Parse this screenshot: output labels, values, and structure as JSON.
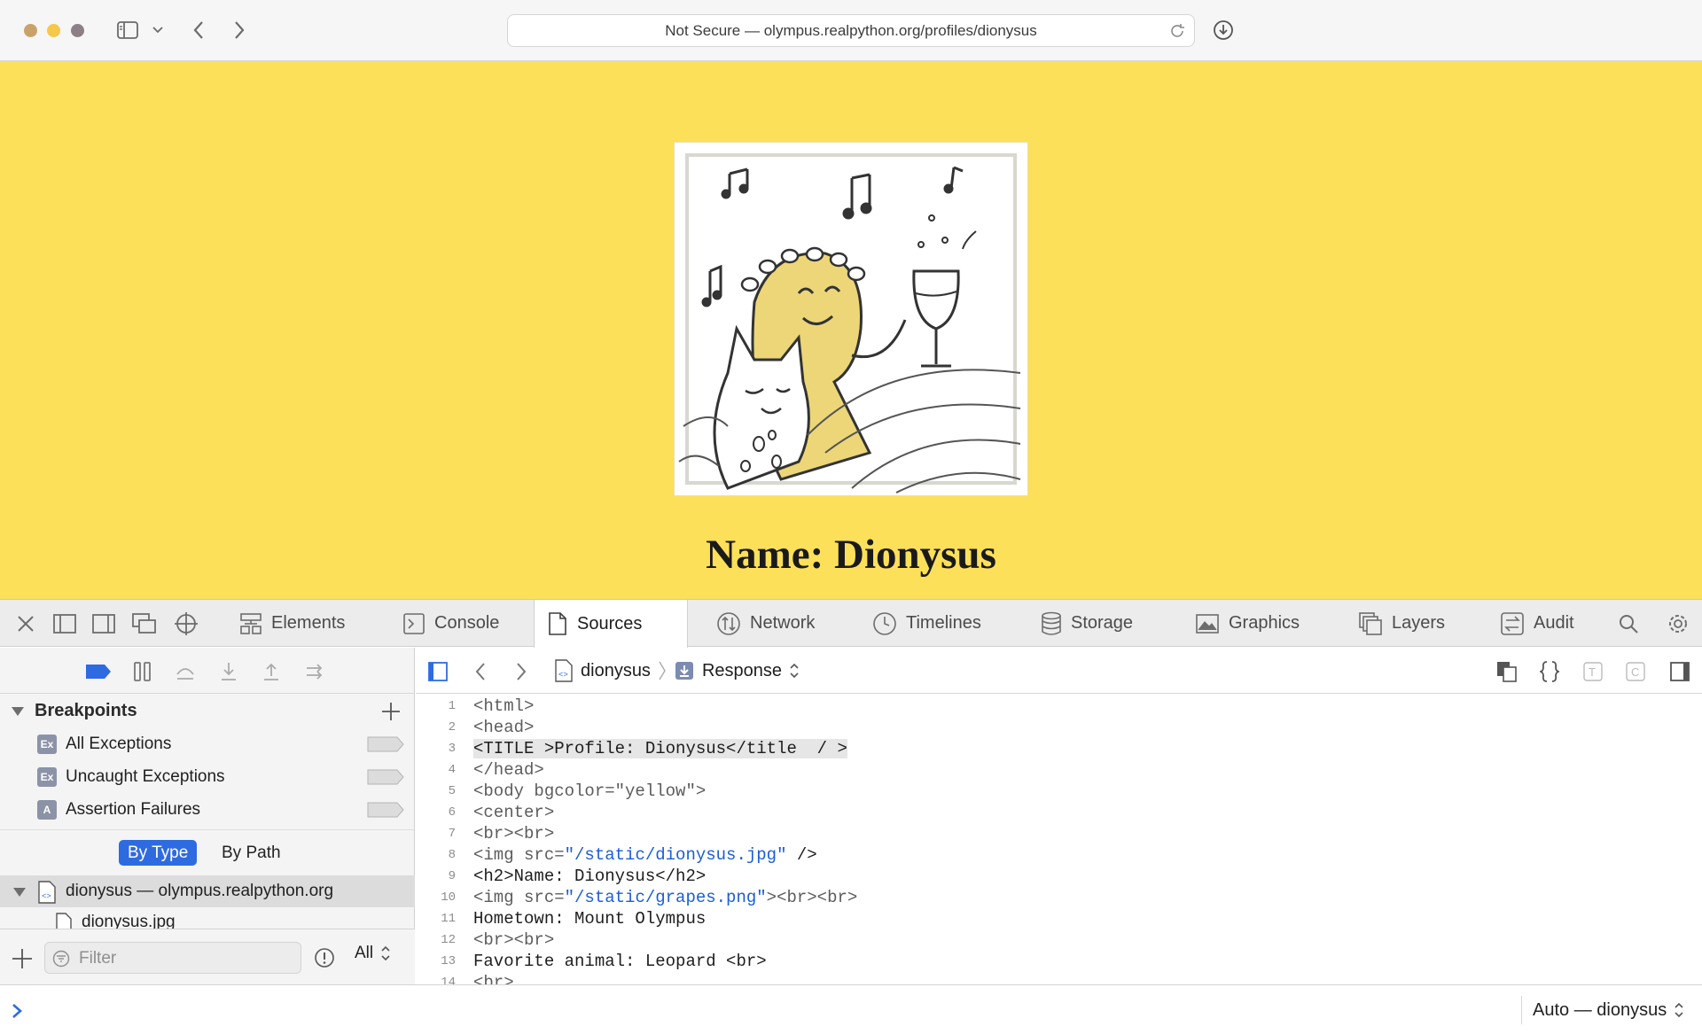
{
  "browser": {
    "address": "Not Secure — olympus.realpython.org/profiles/dionysus",
    "window_controls": [
      "close",
      "minimize",
      "zoom"
    ],
    "toolbar_icons": [
      "sidebar-icon",
      "chevron-down-icon",
      "back-icon",
      "forward-icon",
      "reload-icon",
      "download-icon"
    ]
  },
  "page": {
    "background_color": "#fce05a",
    "image_alt": "dionysus",
    "heading": "Name: Dionysus"
  },
  "devtools": {
    "tabs": [
      {
        "label": "Elements",
        "icon": "elements-icon",
        "active": false
      },
      {
        "label": "Console",
        "icon": "console-icon",
        "active": false
      },
      {
        "label": "Sources",
        "icon": "sources-icon",
        "active": true
      },
      {
        "label": "Network",
        "icon": "network-icon",
        "active": false
      },
      {
        "label": "Timelines",
        "icon": "timelines-icon",
        "active": false
      },
      {
        "label": "Storage",
        "icon": "storage-icon",
        "active": false
      },
      {
        "label": "Graphics",
        "icon": "graphics-icon",
        "active": false
      },
      {
        "label": "Layers",
        "icon": "layers-icon",
        "active": false
      },
      {
        "label": "Audit",
        "icon": "audit-icon",
        "active": false
      }
    ],
    "breakpoints": {
      "title": "Breakpoints",
      "items": [
        {
          "icon_letter": "Ex",
          "label": "All Exceptions"
        },
        {
          "icon_letter": "Ex",
          "label": "Uncaught Exceptions"
        },
        {
          "icon_letter": "A",
          "label": "Assertion Failures"
        }
      ]
    },
    "grouping": {
      "by_type": "By Type",
      "by_path": "By Path",
      "selected": "By Type"
    },
    "resources": {
      "root": "dionysus — olympus.realpython.org",
      "child": "dionysus.jpg"
    },
    "filter": {
      "placeholder": "Filter",
      "value": "",
      "scope": "All"
    },
    "breadcrumb": {
      "file": "dionysus",
      "mode": "Response"
    },
    "source_lines": [
      {
        "n": "1",
        "text": "<html>",
        "highlight": false
      },
      {
        "n": "2",
        "text": "<head>",
        "highlight": false
      },
      {
        "n": "3",
        "text": "<TITLE >Profile: Dionysus</title  / >",
        "highlight": true
      },
      {
        "n": "4",
        "text": "</head>",
        "highlight": false
      },
      {
        "n": "5",
        "text": "<body bgcolor=\"yellow\">",
        "highlight": false
      },
      {
        "n": "6",
        "text": "<center>",
        "highlight": false
      },
      {
        "n": "7",
        "text": "<br><br>",
        "highlight": false
      },
      {
        "n": "8",
        "text": "<img src=\"/static/dionysus.jpg\" />",
        "highlight": false
      },
      {
        "n": "9",
        "text": "<h2>Name: Dionysus</h2>",
        "highlight": false
      },
      {
        "n": "10",
        "text": "<img src=\"/static/grapes.png\"><br><br>",
        "highlight": false
      },
      {
        "n": "11",
        "text": "Hometown: Mount Olympus",
        "highlight": false
      },
      {
        "n": "12",
        "text": "<br><br>",
        "highlight": false
      },
      {
        "n": "13",
        "text": "Favorite animal: Leopard <br>",
        "highlight": false
      },
      {
        "n": "14",
        "text": "<br>",
        "highlight": false
      }
    ],
    "console": {
      "prompt": "›",
      "value": "",
      "context": "Auto — dionysus"
    }
  },
  "colors": {
    "accent": "#2f6be0",
    "page_bg": "#fce05a",
    "string": "#1b5ed6"
  }
}
